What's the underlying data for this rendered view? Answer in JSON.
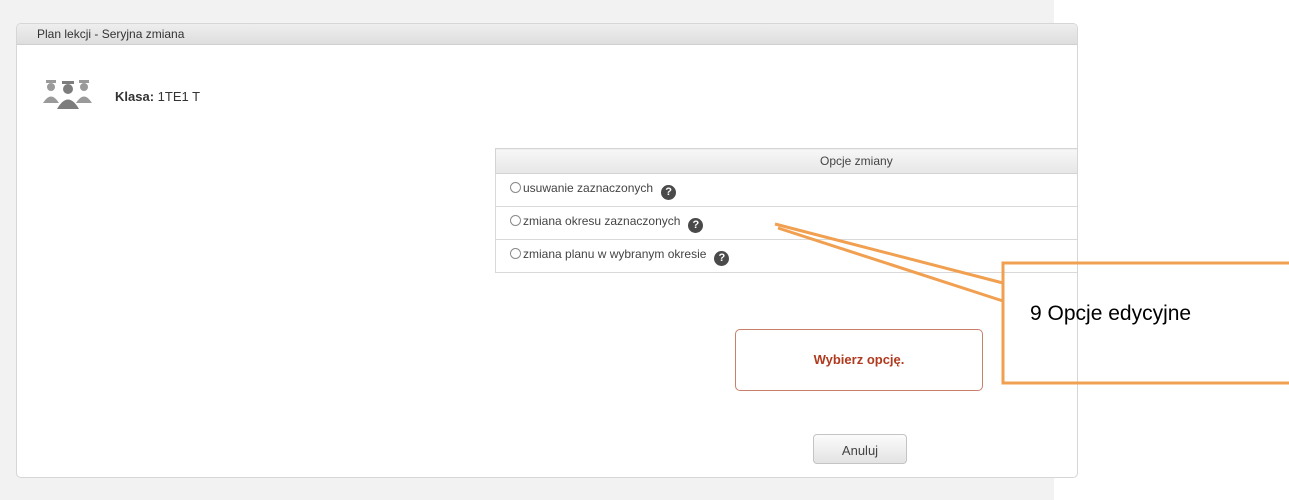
{
  "panel": {
    "title": "Plan lekcji - Seryjna zmiana"
  },
  "class_info": {
    "icon": "group-users-icon",
    "label": "Klasa:",
    "value": "1TE1 T"
  },
  "options": {
    "header": "Opcje zmiany",
    "items": [
      {
        "label": "usuwanie zaznaczonych",
        "help_icon": "question-icon"
      },
      {
        "label": "zmiana okresu zaznaczonych",
        "help_icon": "question-icon"
      },
      {
        "label": "zmiana planu w wybranym okresie",
        "help_icon": "question-icon"
      }
    ]
  },
  "message": {
    "text": "Wybierz opcję."
  },
  "buttons": {
    "cancel_label": "Anuluj"
  },
  "callout": {
    "text": "9 Opcje edycyjne",
    "color": "#f0a050"
  }
}
